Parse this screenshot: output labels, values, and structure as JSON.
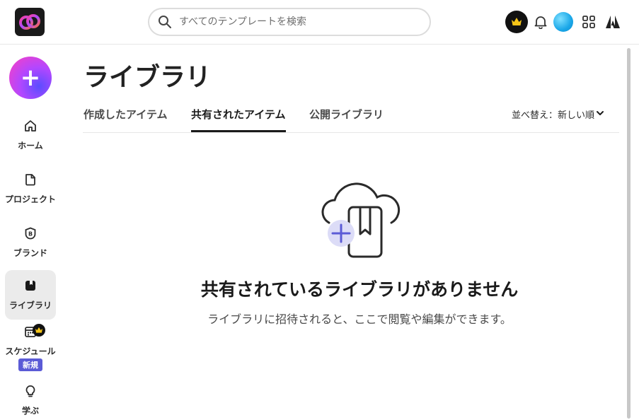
{
  "header": {
    "search_placeholder": "すべてのテンプレートを検索"
  },
  "sidebar": {
    "items": [
      {
        "label": "ホーム"
      },
      {
        "label": "プロジェクト"
      },
      {
        "label": "ブランド"
      },
      {
        "label": "ライブラリ"
      },
      {
        "label": "スケジュール",
        "badge": "新規"
      },
      {
        "label": "学ぶ"
      }
    ]
  },
  "main": {
    "title": "ライブラリ",
    "tabs": [
      {
        "label": "作成したアイテム"
      },
      {
        "label": "共有されたアイテム",
        "active": true
      },
      {
        "label": "公開ライブラリ"
      }
    ],
    "sort_label": "並べ替え：新しい順"
  },
  "empty_state": {
    "title": "共有されているライブラリがありません",
    "description": "ライブラリに招待されると、ここで閲覧や編集ができます。"
  },
  "colors": {
    "accent": "#5b5bd6",
    "active_nav_bg": "#ebebeb"
  }
}
